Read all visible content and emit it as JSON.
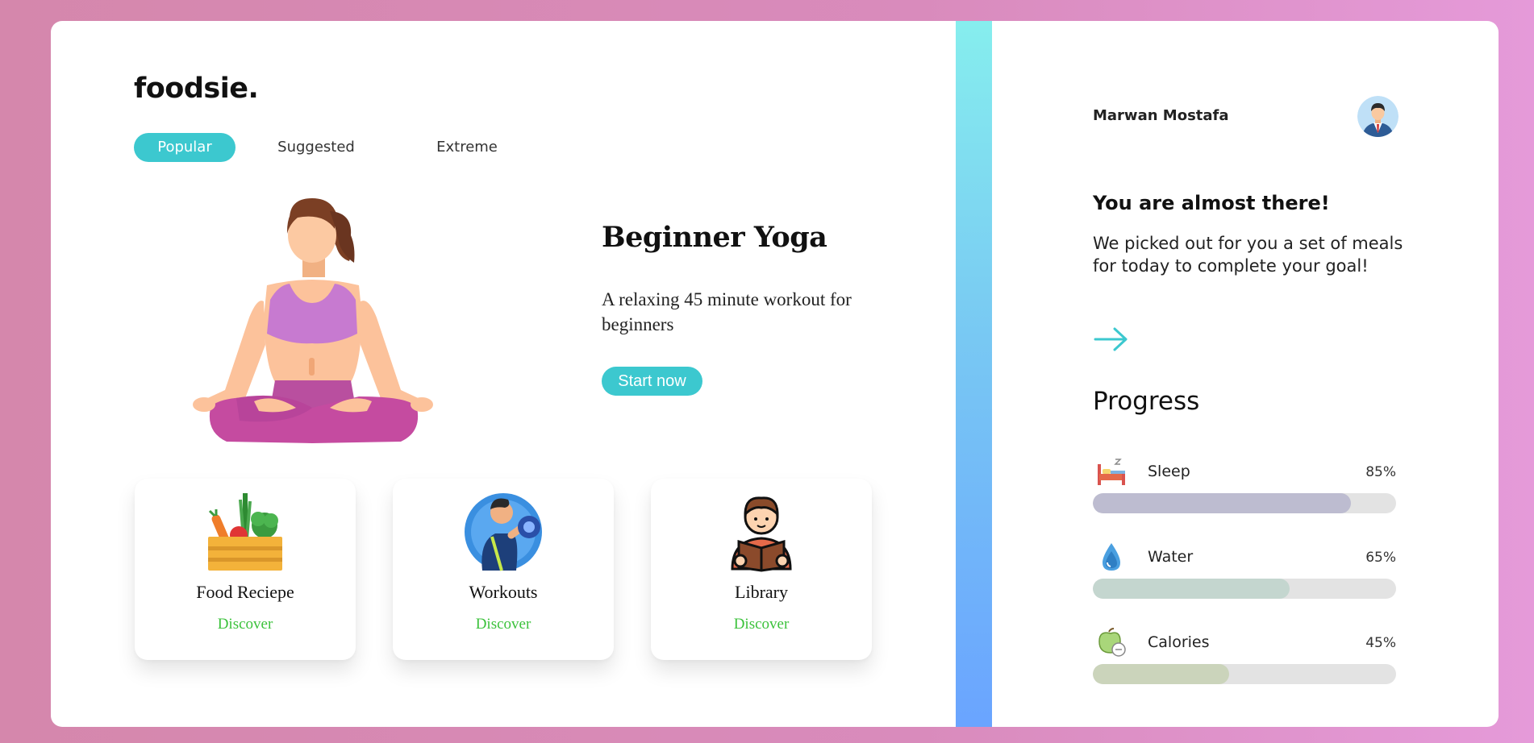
{
  "brand": {
    "logo": "foodsie."
  },
  "tabs": [
    {
      "label": "Popular",
      "active": true
    },
    {
      "label": "Suggested",
      "active": false
    },
    {
      "label": "Extreme",
      "active": false
    }
  ],
  "hero": {
    "title": "Beginner Yoga",
    "description": "A relaxing 45 minute workout for beginners",
    "button_label": "Start now",
    "illustration": "yoga-woman-illustration"
  },
  "cards": [
    {
      "title": "Food Reciepe",
      "link": "Discover",
      "icon": "vegetable-crate-icon"
    },
    {
      "title": "Workouts",
      "link": "Discover",
      "icon": "dumbbell-workout-icon"
    },
    {
      "title": "Library",
      "link": "Discover",
      "icon": "reading-book-icon"
    }
  ],
  "user": {
    "name": "Marwan Mostafa",
    "avatar": "businessman-avatar"
  },
  "promo": {
    "title": "You are almost there!",
    "description": "We picked out for you a set of meals for today to complete your goal!",
    "arrow_icon": "arrow-right-icon"
  },
  "progress": {
    "title": "Progress",
    "items": [
      {
        "label": "Sleep",
        "percent_text": "85%",
        "value": 0.85,
        "color": "#bdbcd0",
        "icon": "bed-icon"
      },
      {
        "label": "Water",
        "percent_text": "65%",
        "value": 0.65,
        "color": "#c4d6cf",
        "icon": "water-drop-icon"
      },
      {
        "label": "Calories",
        "percent_text": "45%",
        "value": 0.45,
        "color": "#cbd4bb",
        "icon": "apple-calories-icon"
      }
    ]
  },
  "colors": {
    "accent": "#3cc8cf",
    "link": "#3cc23c",
    "background_gradient": [
      "#d587ac",
      "#e59ad9"
    ],
    "strip_gradient": [
      "#86eeee",
      "#6aa4ff"
    ]
  }
}
